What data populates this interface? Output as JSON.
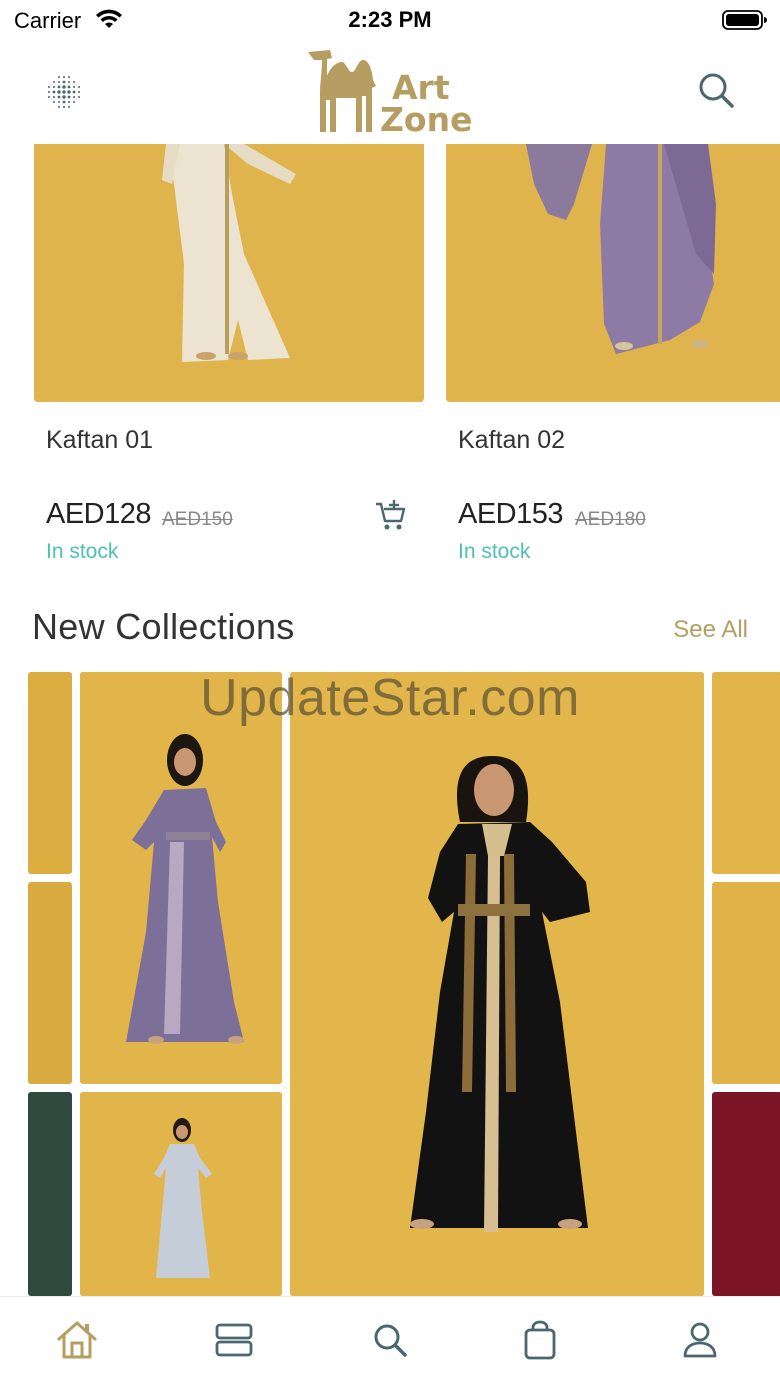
{
  "status_bar": {
    "carrier": "Carrier",
    "time": "2:23 PM"
  },
  "header": {
    "logo_line1": "Art",
    "logo_line2": "Zone",
    "menu_icon": "grid-dots-icon",
    "search_icon": "search-icon"
  },
  "products": [
    {
      "name": "Kaftan 01",
      "price": "AED128",
      "old_price": "AED150",
      "stock": "In stock",
      "has_cart": true
    },
    {
      "name": "Kaftan 02",
      "price": "AED153",
      "old_price": "AED180",
      "stock": "In stock",
      "has_cart": false
    }
  ],
  "new_collections": {
    "title": "New Collections",
    "see_all": "See All"
  },
  "watermark": "UpdateStar.com",
  "tab_bar": {
    "items": [
      "home-icon",
      "categories-icon",
      "search-icon",
      "bag-icon",
      "profile-icon"
    ]
  },
  "colors": {
    "accent_gold": "#b69d62",
    "stock_green": "#4fc1b0",
    "product_bg": "#e3b64c",
    "icon_slate": "#4a6770"
  }
}
